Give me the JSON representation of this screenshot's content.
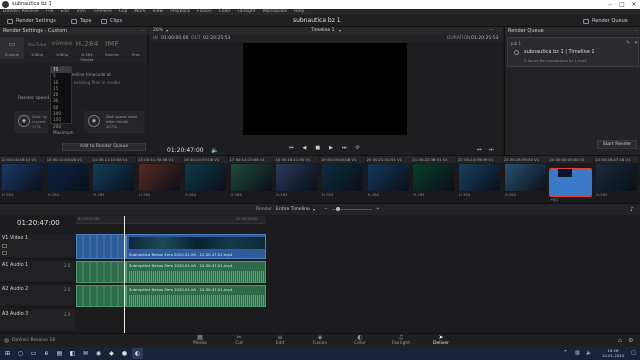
{
  "window": {
    "title": "subnautica bz 1"
  },
  "menu": [
    "DaVinci Resolve",
    "File",
    "Edit",
    "Trim",
    "Timeline",
    "Clip",
    "Mark",
    "View",
    "Playback",
    "Fusion",
    "Color",
    "Fairlight",
    "Workspace",
    "Help"
  ],
  "toolbar": {
    "render_settings": "Render Settings",
    "tape": "Tape",
    "clips": "Clips",
    "project_title": "subnautica bz 1",
    "render_queue": "Render Queue"
  },
  "render_settings": {
    "title": "Render Settings - Custom",
    "presets": [
      {
        "label": "Custom",
        "logo": ""
      },
      {
        "label": "1080p",
        "logo": "YouTube"
      },
      {
        "label": "1080p",
        "logo": "vimeo"
      },
      {
        "label": "H.264 Master",
        "logo": "H.264"
      },
      {
        "label": "Generic",
        "logo": "IMF"
      },
      {
        "label": "Pres",
        "logo": ""
      }
    ],
    "option1": "Start timeline timecode at",
    "option2": "Replace existing files in render",
    "speed_label": "Render speed",
    "speed_value": "75",
    "speed_options": [
      "75",
      "5",
      "10",
      "15",
      "20",
      "30",
      "50",
      "100",
      "150",
      "200",
      "Maximum"
    ],
    "disk1_a": "Disk: 4y",
    "disk1_b": "current",
    "disk1_c": "17%",
    "disk2_a": "Disk space used",
    "disk2_b": "after render",
    "disk2_c": "107%",
    "add_button": "Add to Render Queue"
  },
  "viewer": {
    "zoom": "26%",
    "timeline_name": "Timeline 1",
    "in_label": "IN",
    "in_tc": "01:00:00:00",
    "out_label": "OUT",
    "out_tc": "02:20:25:53",
    "duration_label": "DURATION",
    "duration_tc": "01:20:25:53",
    "timecode": "01:20:47:00"
  },
  "render_queue": {
    "title": "Render Queue",
    "job_id": "Job 1",
    "job_title": "subnautica bz 1 | Timeline 1",
    "job_info": "3 hours 8m  subnautica bz 1.mp4",
    "start_button": "Start Render"
  },
  "thumbs": [
    {
      "num": "12",
      "tc": "00:10:48:14",
      "trk": "V1",
      "codec": "H.264",
      "color": "#1a3a6b"
    },
    {
      "num": "13",
      "tc": "00:11:03:08",
      "trk": "V1",
      "codec": "H.264",
      "color": "#0d2244"
    },
    {
      "num": "14",
      "tc": "00:11:10:08",
      "trk": "V1",
      "codec": "H.264",
      "color": "#123f5a"
    },
    {
      "num": "15",
      "tc": "00:11:30:58",
      "trk": "V1",
      "codec": "H.264",
      "color": "#5a2a20"
    },
    {
      "num": "16",
      "tc": "00:13:57:08",
      "trk": "V1",
      "codec": "H.264",
      "color": "#0f3a4a"
    },
    {
      "num": "17",
      "tc": "00:14:15:06",
      "trk": "V1",
      "codec": "H.264",
      "color": "#1f4a3a"
    },
    {
      "num": "18",
      "tc": "00:16:11:00",
      "trk": "V1",
      "codec": "H.264",
      "color": "#2a3a5a"
    },
    {
      "num": "19",
      "tc": "00:19:00:08",
      "trk": "V1",
      "codec": "H.264",
      "color": "#0c2d3f"
    },
    {
      "num": "20",
      "tc": "00:21:32:51",
      "trk": "V1",
      "codec": "H.264",
      "color": "#14385a"
    },
    {
      "num": "21",
      "tc": "00:22:38:51",
      "trk": "V1",
      "codec": "H.264",
      "color": "#0a3d2a"
    },
    {
      "num": "22",
      "tc": "00:24:39:09",
      "trk": "V1",
      "codec": "H.264",
      "color": "#1a4060"
    },
    {
      "num": "23",
      "tc": "00:26:39:55",
      "trk": "V1",
      "codec": "H.264",
      "color": "#2a5070"
    },
    {
      "num": "24",
      "tc": "00:00:00:00",
      "trk": "V1",
      "codec": "PNG",
      "color": "#3a7ac8"
    },
    {
      "num": "25",
      "tc": "00:26:47:18",
      "trk": "V1",
      "codec": "H.264",
      "color": "#1a2a3a"
    }
  ],
  "timeline": {
    "render_label": "Render",
    "render_mode": "Entire Timeline",
    "timecode": "01:20:47:00",
    "ruler_left": "01:00:00:00",
    "ruler_right": "02:00:00:00",
    "clip_name": "Subnautica  Below Zero 2020.01.06 - 12.50.47.01.mp4",
    "tracks": [
      {
        "id": "V1",
        "name": "Video 1"
      },
      {
        "id": "A1",
        "name": "Audio 1",
        "level": "2.0"
      },
      {
        "id": "A2",
        "name": "Audio 2",
        "level": "2.0"
      },
      {
        "id": "A3",
        "name": "Audio 3",
        "level": "2.0"
      }
    ]
  },
  "pages": [
    {
      "label": "Media",
      "icon": "▦"
    },
    {
      "label": "Cut",
      "icon": "✂"
    },
    {
      "label": "Edit",
      "icon": "≡"
    },
    {
      "label": "Fusion",
      "icon": "◈"
    },
    {
      "label": "Color",
      "icon": "◐"
    },
    {
      "label": "Fairlight",
      "icon": "♫"
    },
    {
      "label": "Deliver",
      "icon": "➤"
    }
  ],
  "footer": {
    "app_name": "DaVinci Resolve 16"
  },
  "taskbar": {
    "time": "19:16",
    "date": "10-01-2020"
  }
}
